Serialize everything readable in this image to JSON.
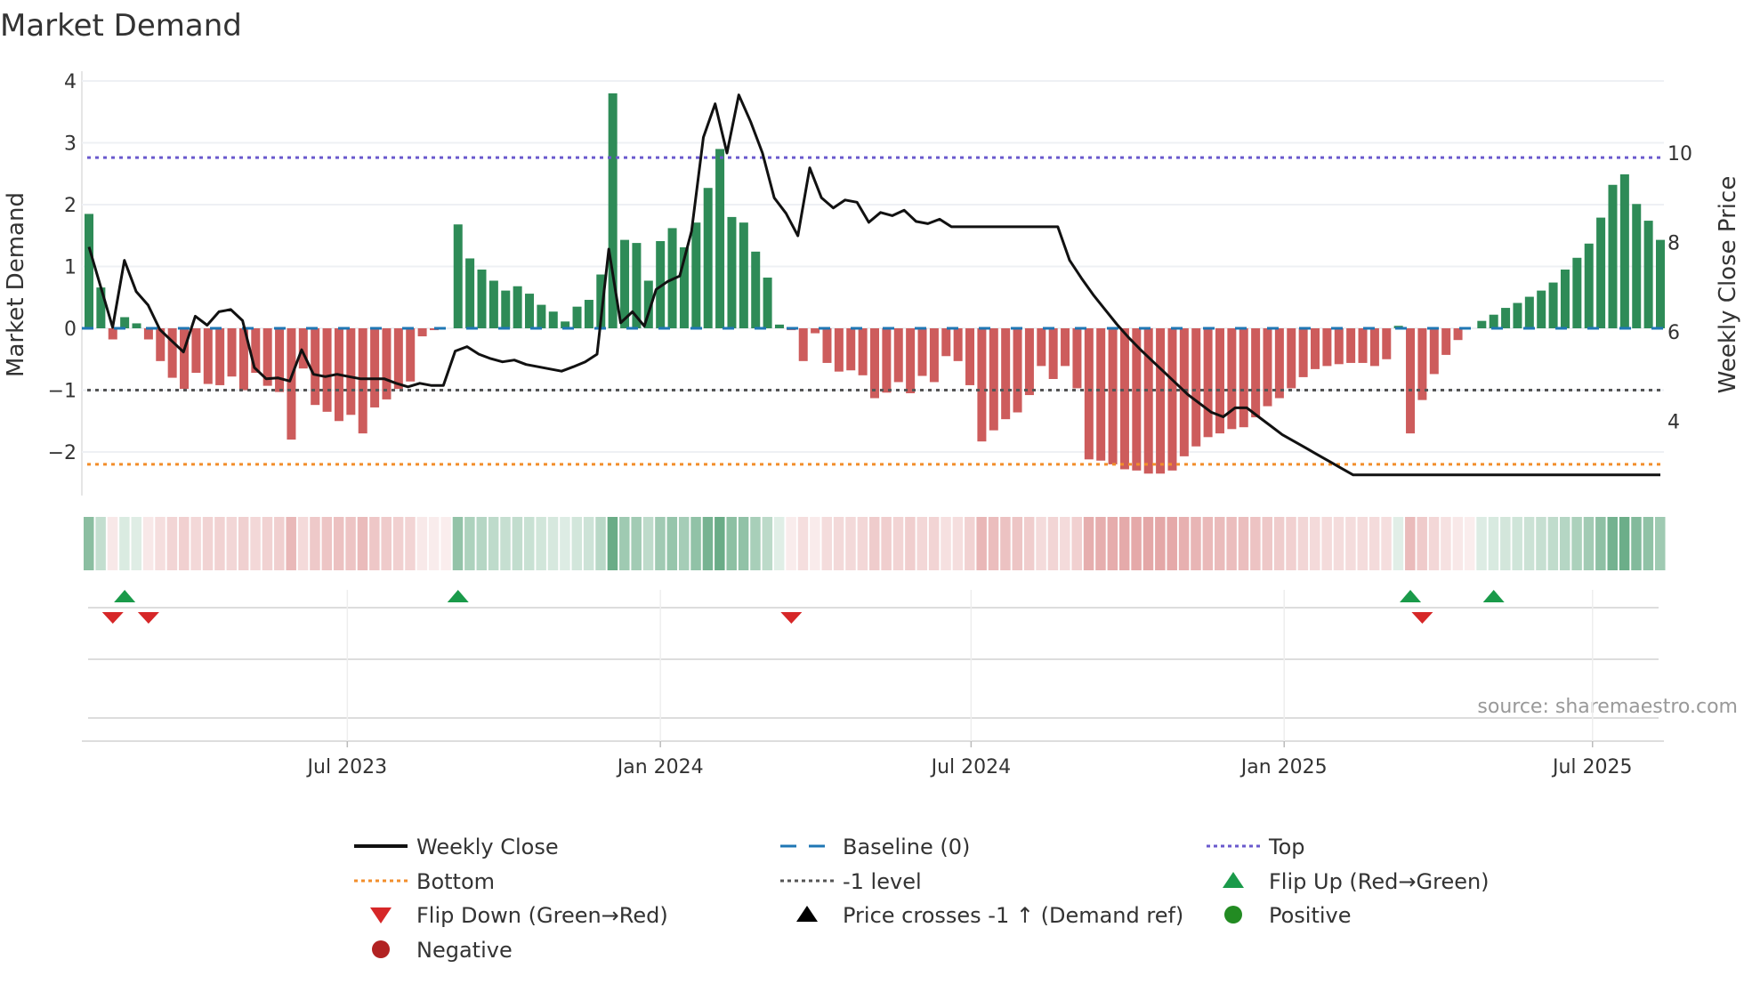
{
  "chart_data": {
    "type": "bar",
    "title": "Market Demand",
    "ylabel": "Market Demand",
    "y2label": "Weekly Close Price",
    "ylim": [
      -2.7,
      4.1
    ],
    "y2lim": [
      2.3,
      11.6
    ],
    "yticks": [
      "4",
      "3",
      "2",
      "1",
      "0",
      "−1",
      "−2"
    ],
    "ytick_values": [
      4,
      3,
      2,
      1,
      0,
      -1,
      -2
    ],
    "y2ticks": [
      "10",
      "8",
      "6",
      "4"
    ],
    "y2tick_values": [
      10,
      8,
      6,
      4
    ],
    "xticks": [
      {
        "label": "Jul 2023",
        "week": 21.7
      },
      {
        "label": "Jan 2024",
        "week": 48
      },
      {
        "label": "Jul 2024",
        "week": 74.1
      },
      {
        "label": "Jan 2025",
        "week": 100.4
      },
      {
        "label": "Jul 2025",
        "week": 126.3
      }
    ],
    "reference_lines": {
      "top": 2.76,
      "bottom": -2.2,
      "minus_one": -1,
      "baseline": 0
    },
    "demand": [
      1.85,
      0.66,
      -0.18,
      0.18,
      0.08,
      -0.18,
      -0.53,
      -0.8,
      -0.98,
      -0.72,
      -0.9,
      -0.92,
      -0.78,
      -1.0,
      -0.72,
      -0.93,
      -1.03,
      -1.8,
      -0.65,
      -1.24,
      -1.35,
      -1.5,
      -1.4,
      -1.7,
      -1.28,
      -1.15,
      -0.98,
      -0.86,
      -0.13,
      -0.03,
      0,
      1.68,
      1.13,
      0.95,
      0.77,
      0.61,
      0.68,
      0.56,
      0.38,
      0.27,
      0.11,
      0.35,
      0.46,
      0.87,
      3.8,
      1.43,
      1.38,
      0.77,
      1.41,
      1.62,
      1.31,
      1.71,
      2.27,
      2.9,
      1.8,
      1.71,
      1.24,
      0.82,
      0.06,
      -0.03,
      -0.53,
      -0.08,
      -0.56,
      -0.7,
      -0.68,
      -0.76,
      -1.13,
      -1.04,
      -0.87,
      -1.05,
      -0.77,
      -0.87,
      -0.45,
      -0.53,
      -0.92,
      -1.83,
      -1.65,
      -1.47,
      -1.36,
      -1.08,
      -0.61,
      -0.82,
      -0.61,
      -0.97,
      -2.12,
      -2.14,
      -2.2,
      -2.28,
      -2.3,
      -2.35,
      -2.35,
      -2.3,
      -2.07,
      -1.91,
      -1.76,
      -1.7,
      -1.63,
      -1.6,
      -1.44,
      -1.26,
      -1.13,
      -0.97,
      -0.79,
      -0.66,
      -0.61,
      -0.58,
      -0.56,
      -0.56,
      -0.61,
      -0.5,
      0.04,
      -1.7,
      -1.16,
      -0.74,
      -0.43,
      -0.19,
      0,
      0.12,
      0.22,
      0.33,
      0.41,
      0.51,
      0.61,
      0.74,
      0.95,
      1.14,
      1.37,
      1.79,
      2.32,
      2.49,
      2.01,
      1.74,
      1.43
    ],
    "weekly_close": [
      7.9,
      7.0,
      6.1,
      7.6,
      6.9,
      6.6,
      6.05,
      5.8,
      5.55,
      6.35,
      6.15,
      6.45,
      6.5,
      6.25,
      5.2,
      4.95,
      4.97,
      4.9,
      5.6,
      5.05,
      5.0,
      5.05,
      5.0,
      4.95,
      4.95,
      4.95,
      4.85,
      4.77,
      4.85,
      4.8,
      4.8,
      5.57,
      5.67,
      5.5,
      5.4,
      5.33,
      5.37,
      5.27,
      5.22,
      5.17,
      5.12,
      5.22,
      5.33,
      5.5,
      7.85,
      6.2,
      6.45,
      6.13,
      6.95,
      7.13,
      7.25,
      8.25,
      10.35,
      11.1,
      10.0,
      11.3,
      10.7,
      10.0,
      9.0,
      8.65,
      8.15,
      9.67,
      9.0,
      8.77,
      8.95,
      8.9,
      8.45,
      8.67,
      8.6,
      8.72,
      8.47,
      8.42,
      8.52,
      8.35,
      8.35,
      8.35,
      8.35,
      8.35,
      8.35,
      8.35,
      8.35,
      8.35,
      8.35,
      7.6,
      7.2,
      6.83,
      6.5,
      6.17,
      5.87,
      5.6,
      5.35,
      5.1,
      4.85,
      4.6,
      4.4,
      4.2,
      4.1,
      4.3,
      4.3,
      4.1,
      3.9,
      3.7,
      3.55,
      3.4,
      3.25,
      3.1,
      2.95,
      2.8,
      2.8,
      2.8,
      2.8,
      2.8,
      2.8,
      2.8,
      2.8,
      2.8,
      2.8,
      2.8,
      2.8,
      2.8,
      2.8,
      2.8,
      2.8,
      2.8,
      2.8,
      2.8,
      2.8,
      2.8,
      2.8,
      2.8,
      2.8,
      2.8,
      2.8,
      2.8
    ],
    "flip_up_weeks": [
      3,
      31,
      111,
      118
    ],
    "flip_down_weeks": [
      2,
      5,
      59,
      112
    ],
    "legend": [
      {
        "label": "Weekly Close",
        "symbol": "line",
        "color": "#111111"
      },
      {
        "label": "Baseline (0)",
        "symbol": "dash",
        "color": "#1f77b4"
      },
      {
        "label": "Top",
        "symbol": "dot",
        "color": "#6a5acd"
      },
      {
        "label": "Bottom",
        "symbol": "dot",
        "color": "#f28e2b"
      },
      {
        "label": "-1 level",
        "symbol": "dot",
        "color": "#555555"
      },
      {
        "label": "Flip Up (Red→Green)",
        "symbol": "tri-up",
        "color": "#1a9a4a"
      },
      {
        "label": "Flip Down (Green→Red)",
        "symbol": "tri-down",
        "color": "#d62728"
      },
      {
        "label": "Price crosses -1 ↑ (Demand ref)",
        "symbol": "tri-up",
        "color": "#000000"
      },
      {
        "label": "Positive",
        "symbol": "circle",
        "color": "#228b22"
      },
      {
        "label": "Negative",
        "symbol": "circle",
        "color": "#b22222"
      }
    ],
    "legend_placement": "bottom",
    "source": "source: sharemaestro.com"
  },
  "colors": {
    "positive": "#2e8b57",
    "negative": "#cd5c5c",
    "top": "#6a5acd",
    "bottom": "#f28e2b",
    "minus_one": "#555555",
    "baseline": "#1f77b4"
  }
}
